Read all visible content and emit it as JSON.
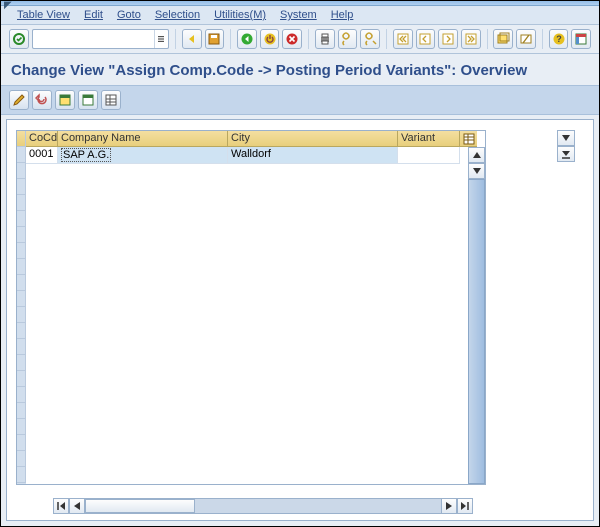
{
  "menubar": {
    "table_view": "Table View",
    "edit": "Edit",
    "goto": "Goto",
    "selection": "Selection",
    "utilities": "Utilities(M)",
    "system": "System",
    "help": "Help"
  },
  "toolbar_icons": {
    "enter": "enter-icon",
    "command_field": "",
    "save": "save-icon",
    "back": "back-icon",
    "exit": "exit-icon",
    "cancel": "cancel-icon",
    "print": "print-icon",
    "find": "find-icon",
    "find_next": "find-next-icon",
    "first_page": "first-page-icon",
    "prev_page": "prev-page-icon",
    "next_page": "next-page-icon",
    "last_page": "last-page-icon",
    "new_session": "new-session-icon",
    "shortcut": "shortcut-icon",
    "help": "help-icon",
    "layout": "layout-icon"
  },
  "page_title": "Change View \"Assign Comp.Code -> Posting Period Variants\": Overview",
  "app_toolbar": {
    "change": "change-icon",
    "undo": "undo-icon",
    "select_all": "select-all-icon",
    "deselect_all": "deselect-all-icon",
    "table_settings": "table-settings-icon"
  },
  "grid": {
    "columns": {
      "cocd": "CoCd",
      "company_name": "Company Name",
      "city": "City",
      "variant": "Variant"
    },
    "rows": [
      {
        "cocd": "0001",
        "company_name": "SAP A.G.",
        "city": "Walldorf",
        "variant": ""
      }
    ]
  }
}
